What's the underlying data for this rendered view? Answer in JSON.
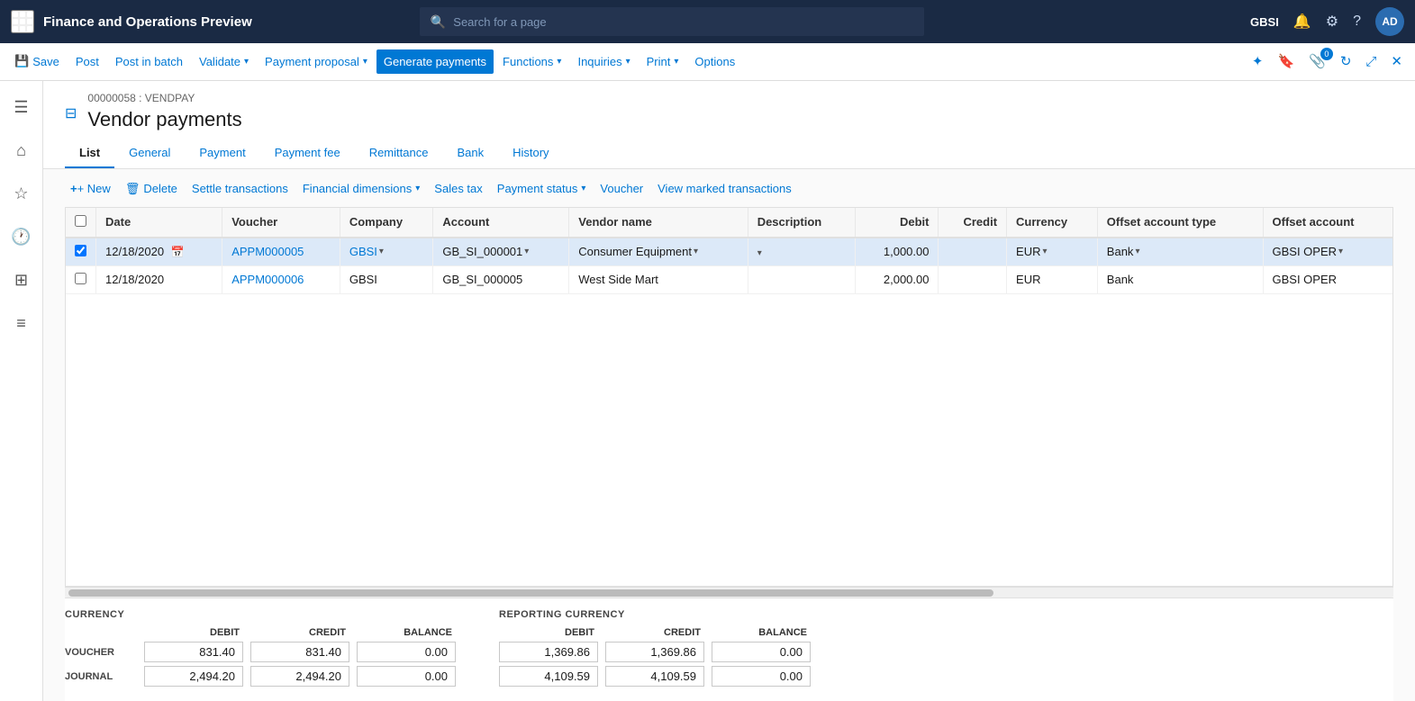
{
  "app": {
    "title": "Finance and Operations Preview",
    "user": "GBSI",
    "avatar": "AD"
  },
  "search": {
    "placeholder": "Search for a page"
  },
  "toolbar": {
    "save": "Save",
    "post": "Post",
    "post_in_batch": "Post in batch",
    "validate": "Validate",
    "payment_proposal": "Payment proposal",
    "generate_payments": "Generate payments",
    "functions": "Functions",
    "inquiries": "Inquiries",
    "print": "Print",
    "options": "Options"
  },
  "page": {
    "breadcrumb": "00000058 : VENDPAY",
    "title": "Vendor payments"
  },
  "tabs": [
    {
      "id": "list",
      "label": "List",
      "active": true
    },
    {
      "id": "general",
      "label": "General",
      "active": false
    },
    {
      "id": "payment",
      "label": "Payment",
      "active": false
    },
    {
      "id": "payment_fee",
      "label": "Payment fee",
      "active": false
    },
    {
      "id": "remittance",
      "label": "Remittance",
      "active": false
    },
    {
      "id": "bank",
      "label": "Bank",
      "active": false
    },
    {
      "id": "history",
      "label": "History",
      "active": false
    }
  ],
  "actions": {
    "new": "+ New",
    "delete": "Delete",
    "settle": "Settle transactions",
    "financial_dimensions": "Financial dimensions",
    "sales_tax": "Sales tax",
    "payment_status": "Payment status",
    "voucher": "Voucher",
    "view_marked": "View marked transactions"
  },
  "table": {
    "columns": [
      {
        "id": "check",
        "label": ""
      },
      {
        "id": "date",
        "label": "Date"
      },
      {
        "id": "voucher",
        "label": "Voucher"
      },
      {
        "id": "company",
        "label": "Company"
      },
      {
        "id": "account",
        "label": "Account"
      },
      {
        "id": "vendor_name",
        "label": "Vendor name"
      },
      {
        "id": "description",
        "label": "Description"
      },
      {
        "id": "debit",
        "label": "Debit",
        "numeric": true
      },
      {
        "id": "credit",
        "label": "Credit",
        "numeric": true
      },
      {
        "id": "currency",
        "label": "Currency"
      },
      {
        "id": "offset_account_type",
        "label": "Offset account type"
      },
      {
        "id": "offset_account",
        "label": "Offset account"
      }
    ],
    "rows": [
      {
        "selected": true,
        "date": "12/18/2020",
        "voucher": "APPM000005",
        "company": "GBSI",
        "account": "GB_SI_000001",
        "vendor_name": "Consumer Equipment",
        "description": "",
        "debit": "1,000.00",
        "credit": "",
        "currency": "EUR",
        "offset_account_type": "Bank",
        "offset_account": "GBSI OPER"
      },
      {
        "selected": false,
        "date": "12/18/2020",
        "voucher": "APPM000006",
        "company": "GBSI",
        "account": "GB_SI_000005",
        "vendor_name": "West Side Mart",
        "description": "",
        "debit": "2,000.00",
        "credit": "",
        "currency": "EUR",
        "offset_account_type": "Bank",
        "offset_account": "GBSI OPER"
      }
    ]
  },
  "summary": {
    "currency_title": "CURRENCY",
    "reporting_title": "REPORTING CURRENCY",
    "col_headers": [
      "DEBIT",
      "CREDIT",
      "BALANCE"
    ],
    "rows": [
      {
        "label": "VOUCHER",
        "currency_debit": "831.40",
        "currency_credit": "831.40",
        "currency_balance": "0.00",
        "reporting_debit": "1,369.86",
        "reporting_credit": "1,369.86",
        "reporting_balance": "0.00"
      },
      {
        "label": "JOURNAL",
        "currency_debit": "2,494.20",
        "currency_credit": "2,494.20",
        "currency_balance": "0.00",
        "reporting_debit": "4,109.59",
        "reporting_credit": "4,109.59",
        "reporting_balance": "0.00"
      }
    ]
  }
}
